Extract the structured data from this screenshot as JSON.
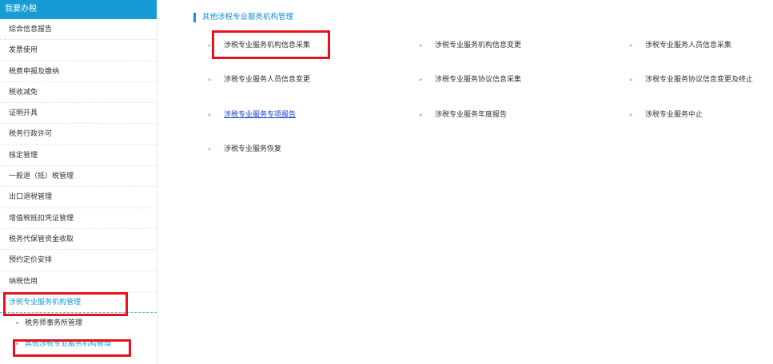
{
  "sidebar": {
    "header": "我要办税",
    "items": [
      {
        "label": "综合信息报告"
      },
      {
        "label": "发票使用"
      },
      {
        "label": "税费申报及缴纳"
      },
      {
        "label": "税收减免"
      },
      {
        "label": "证明开具"
      },
      {
        "label": "税务行政许可"
      },
      {
        "label": "核定管理"
      },
      {
        "label": "一般退（抵）税管理"
      },
      {
        "label": "出口退税管理"
      },
      {
        "label": "增值税抵扣凭证管理"
      },
      {
        "label": "税务代保管资金收取"
      },
      {
        "label": "预约定价安排"
      },
      {
        "label": "纳税信用"
      },
      {
        "label": "涉税专业服务机构管理"
      }
    ],
    "subitems": [
      {
        "label": "税务师事务所管理"
      },
      {
        "label": "其他涉税专业服务机构管理"
      }
    ]
  },
  "main": {
    "section_title": "其他涉税专业服务机构管理",
    "links": [
      {
        "label": "涉税专业服务机构信息采集"
      },
      {
        "label": "涉税专业服务机构信息变更"
      },
      {
        "label": "涉税专业服务人员信息采集"
      },
      {
        "label": "涉税专业服务人员信息变更"
      },
      {
        "label": "涉税专业服务协议信息采集"
      },
      {
        "label": "涉税专业服务协议信息变更及终止"
      },
      {
        "label": "涉税专业服务专项报告"
      },
      {
        "label": "涉税专业服务年度报告"
      },
      {
        "label": "涉税专业服务中止"
      },
      {
        "label": "涉税专业服务恢复"
      }
    ]
  },
  "colors": {
    "accent": "#169bd5",
    "highlight": "#e8111f",
    "link": "#1a3fcc"
  },
  "icons": {
    "bullet": "»"
  }
}
